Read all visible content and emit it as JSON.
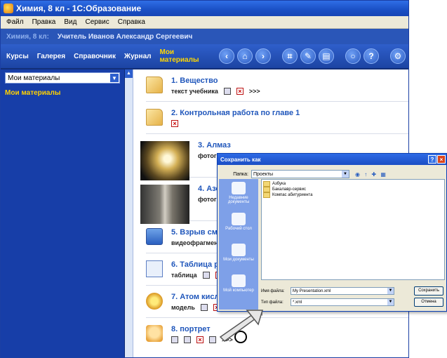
{
  "window": {
    "title": "Химия, 8 кл - 1С:Образование"
  },
  "menu": [
    "Файл",
    "Правка",
    "Вид",
    "Сервис",
    "Справка"
  ],
  "userbar": {
    "class": "Химия, 8 кл:",
    "user": "Учитель Иванов Александр Сергеевич"
  },
  "nav": {
    "tabs": [
      "Курсы",
      "Галерея",
      "Справочник",
      "Журнал",
      "Мои материалы"
    ],
    "active_tab": "Мои материалы",
    "icons": [
      "back-icon",
      "home-icon",
      "forward-icon",
      "fullscreen-icon",
      "bookmark-icon",
      "print-icon",
      "search-icon",
      "help-icon",
      "settings-icon"
    ]
  },
  "sidebar": {
    "select_value": "Мои материалы",
    "title": "Мои материалы"
  },
  "items": [
    {
      "num": "1.",
      "title": "Вещество",
      "type": "текст учебника",
      "more": ">>>"
    },
    {
      "num": "2.",
      "title": "Контрольная работа по главе 1"
    },
    {
      "num": "3.",
      "title": "Алмаз",
      "type": "фотография"
    },
    {
      "num": "4.",
      "title": "Азот",
      "type": "фотография"
    },
    {
      "num": "5.",
      "title": "Взрыв смеси вод",
      "type": "видеофрагмент"
    },
    {
      "num": "6.",
      "title": "Таблица растворим",
      "type": "таблица"
    },
    {
      "num": "7.",
      "title": "Атом кислорода",
      "type": "модель"
    },
    {
      "num": "8.",
      "title": "портрет",
      "more": ">>>"
    }
  ],
  "dialog": {
    "title": "Сохранить как",
    "folder_label": "Папка:",
    "folder_value": "Проекты",
    "places": [
      "Недавние документы",
      "Рабочий стол",
      "Мои документы",
      "Мой компьютер"
    ],
    "files": [
      "Азбука",
      "Бакалавр-сервис",
      "Компас абитуриента"
    ],
    "filename_label": "Имя файла:",
    "filename_value": "My Presentation.xml",
    "filetype_label": "Тип файла:",
    "filetype_value": "*.xml",
    "save_label": "Сохранить",
    "cancel_label": "Отмена"
  },
  "colors": {
    "title_bar": "#1a4fc4",
    "nav": "#1c44a3",
    "sidebar": "#173ea8",
    "link": "#1f56bb",
    "active_tab": "#ffd700"
  }
}
